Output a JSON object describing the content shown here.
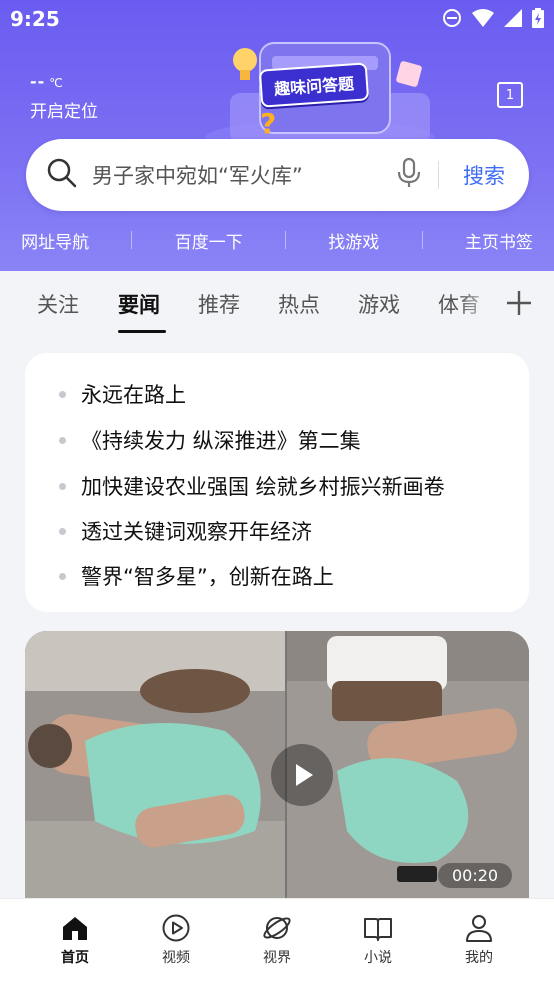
{
  "status": {
    "time": "9:25"
  },
  "weather": {
    "temp": "--",
    "unit": "℃",
    "location": "开启定位"
  },
  "banner": {
    "label": "趣味问答题"
  },
  "tab_count": "1",
  "search": {
    "placeholder": "男子家中宛如“军火库”",
    "button": "搜索"
  },
  "quick_nav": [
    "网址导航",
    "百度一下",
    "找游戏",
    "主页书签"
  ],
  "channels": {
    "items": [
      "关注",
      "要闻",
      "推荐",
      "热点",
      "游戏",
      "体育"
    ],
    "active": "要闻"
  },
  "hot_news": [
    "永远在路上",
    "《持续发力 纵深推进》第二集",
    "加快建设农业强国 绘就乡村振兴新画卷",
    "透过关键词观察开年经济",
    "警界“智多星”，创新在路上"
  ],
  "video": {
    "duration": "00:20"
  },
  "tabbar": {
    "items": [
      {
        "label": "首页",
        "icon": "home-icon"
      },
      {
        "label": "视频",
        "icon": "play-circle-icon"
      },
      {
        "label": "视界",
        "icon": "planet-icon"
      },
      {
        "label": "小说",
        "icon": "book-icon"
      },
      {
        "label": "我的",
        "icon": "user-icon"
      }
    ],
    "active": "首页"
  },
  "colors": {
    "header": "#6a5cf0",
    "accent": "#3f6cf4"
  }
}
